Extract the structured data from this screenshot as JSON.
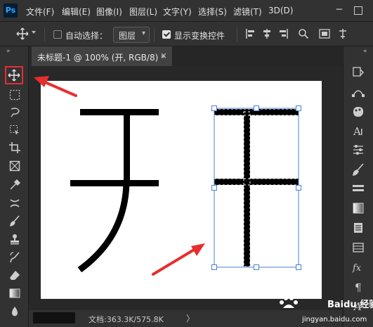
{
  "app": {
    "logo": "Ps",
    "menu": [
      "文件(F)",
      "编辑(E)",
      "图像(I)",
      "图层(L)",
      "文字(Y)",
      "选择(S)",
      "滤镜(T)",
      "3D(D)"
    ],
    "window_controls": [
      "minimize-icon",
      "maximize-icon"
    ]
  },
  "options_bar": {
    "tool_icon": "move-icon",
    "auto_select_label": "自动选择：",
    "auto_select_checked": false,
    "layer_select_value": "图层",
    "show_transform_label": "显示变换控件",
    "show_transform_checked": true,
    "align_icons": [
      "align-left-icon",
      "align-center-icon",
      "align-right-icon",
      "search-icon",
      "frame-icon",
      "distribute-icon"
    ]
  },
  "document": {
    "tab_title": "未标题-1 @ 100% (开, RGB/8) *",
    "close_glyph": "×",
    "canvas_chars": [
      "开"
    ]
  },
  "left_tools": [
    "move-icon",
    "marquee-icon",
    "lasso-icon",
    "object-select-icon",
    "crop-icon",
    "frame-tool-icon",
    "eyedropper-icon",
    "healing-icon",
    "brush-icon",
    "stamp-icon",
    "history-brush-icon",
    "eraser-icon",
    "gradient-icon",
    "blur-icon"
  ],
  "right_tools": [
    "collapse-icon",
    "history-icon",
    "paths-icon",
    "color-icon",
    "character-icon",
    "adjustments-icon",
    "brushes-icon",
    "swatches-icon",
    "gradients-icon",
    "layers-icon",
    "channels-icon",
    "glyphs-icon",
    "paragraph-icon",
    "paragraph-style-icon"
  ],
  "status": {
    "doc_info": "文档:363.3K/575.8K",
    "arrow": "〉"
  },
  "watermark": {
    "text": "Baidu 经验",
    "url": "jingyan.baidu.com"
  },
  "colors": {
    "highlight": "#e62e2e",
    "selection": "#4a7fd6",
    "background": "#282828"
  }
}
